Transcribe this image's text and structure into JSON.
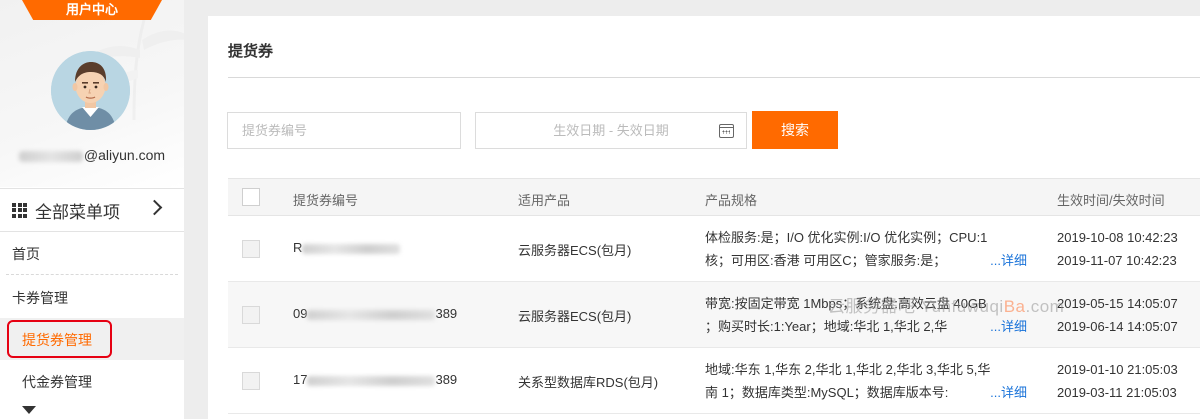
{
  "sidebar": {
    "user_center_tab": "用户中心",
    "email_suffix": "@aliyun.com",
    "all_menu_label": "全部菜单项",
    "menu": {
      "home": "首页",
      "card_management": "卡券管理",
      "voucher_management": "提货券管理",
      "cash_voucher_management": "代金券管理"
    }
  },
  "main": {
    "title": "提货券",
    "search": {
      "voucher_placeholder": "提货券编号",
      "date_placeholder": "生效日期 - 失效日期",
      "button_label": "搜索"
    },
    "table": {
      "headers": [
        "提货券编号",
        "适用产品",
        "产品规格",
        "生效时间/失效时间"
      ],
      "rows": [
        {
          "id_prefix": "R",
          "id_suffix": "",
          "product": "云服务器ECS(包月)",
          "spec_line1": "体检服务:是；I/O 优化实例:I/O 优化实例；CPU:1",
          "spec_line2": "核；可用区:香港 可用区C；管家服务:是；",
          "detail": "...详细",
          "start": "2019-10-08 10:42:23",
          "end": "2019-11-07 10:42:23"
        },
        {
          "id_prefix": "09",
          "id_suffix": "389",
          "product": "云服务器ECS(包月)",
          "spec_line1": "带宽:按固定带宽 1Mbps；系统盘:高效云盘 40GB",
          "spec_line2": "；购买时长:1:Year；地域:华北 1,华北 2,华",
          "detail": "...详细",
          "start": "2019-05-15 14:05:07",
          "end": "2019-06-14 14:05:07"
        },
        {
          "id_prefix": "17",
          "id_suffix": "389",
          "product": "关系型数据库RDS(包月)",
          "spec_line1": "地域:华东 1,华东 2,华北 1,华北 2,华北 3,华北 5,华",
          "spec_line2": "南 1；数据库类型:MySQL；数据库版本号:",
          "detail": "...详细",
          "start": "2019-01-10 21:05:03",
          "end": "2019-03-11 21:05:03"
        }
      ]
    }
  },
  "watermark": {
    "prefix": "云服务器吧 Yunfuwuqi",
    "highlight": "Ba",
    "suffix": ".com"
  },
  "colors": {
    "accent": "#ff6a00",
    "link": "#1a73d9",
    "highlight_border": "#e60012"
  }
}
